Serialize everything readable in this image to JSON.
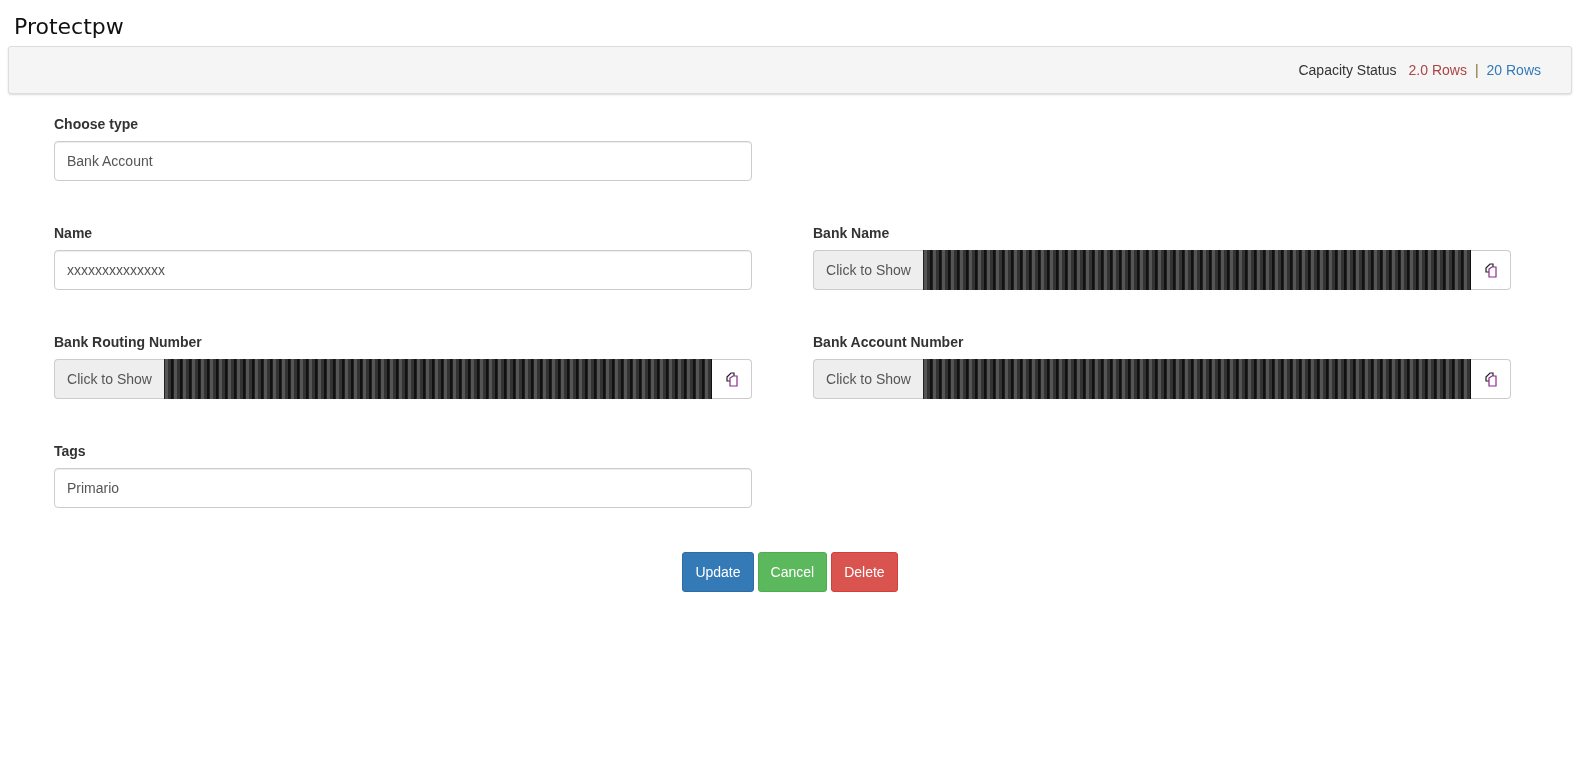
{
  "app_title": "Protectpw",
  "capacity": {
    "label": "Capacity Status",
    "used": "2.0 Rows",
    "separator": "|",
    "total": "20 Rows"
  },
  "form_rows": [
    [
      {
        "kind": "text",
        "label": "Choose type",
        "value": "Bank Account"
      }
    ],
    [
      {
        "kind": "text",
        "label": "Name",
        "value": "xxxxxxxxxxxxxx"
      },
      {
        "kind": "secret",
        "label": "Bank Name",
        "reveal": "Click to Show"
      }
    ],
    [
      {
        "kind": "secret",
        "label": "Bank Routing Number",
        "reveal": "Click to Show"
      },
      {
        "kind": "secret",
        "label": "Bank Account Number",
        "reveal": "Click to Show"
      }
    ],
    [
      {
        "kind": "text",
        "label": "Tags",
        "value": "Primario"
      }
    ]
  ],
  "buttons": [
    {
      "kind": "primary",
      "label": "Update"
    },
    {
      "kind": "success",
      "label": "Cancel"
    },
    {
      "kind": "danger",
      "label": "Delete"
    }
  ]
}
